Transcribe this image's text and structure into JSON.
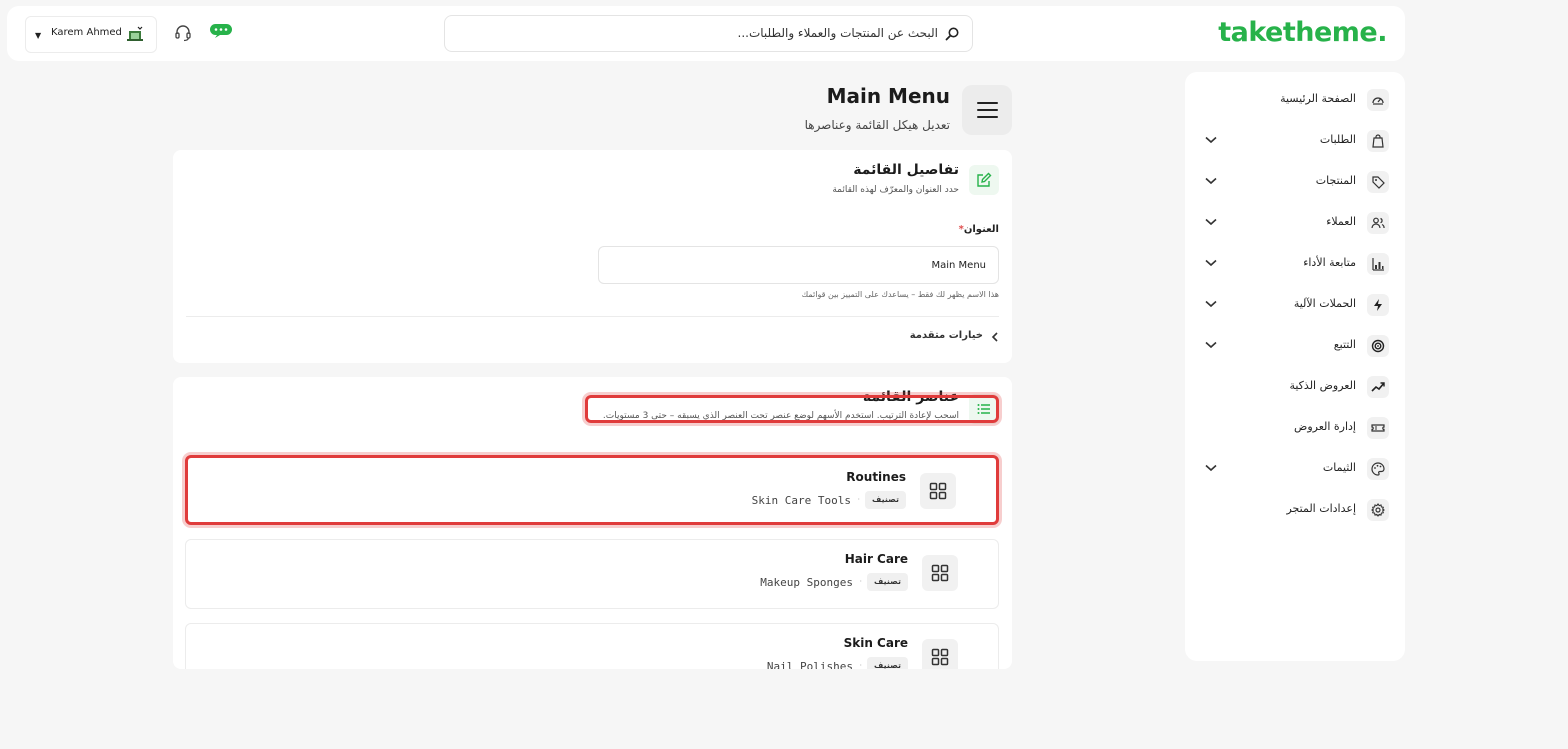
{
  "header": {
    "logo": "taketheme.",
    "search_placeholder": "البحث عن المنتجات والعملاء والطلبات...",
    "user_name": "Karem Ahmed"
  },
  "sidebar": {
    "items": [
      {
        "label": "الصفحة الرئيسية",
        "icon": "dashboard-icon",
        "has_chevron": false
      },
      {
        "label": "الطلبات",
        "icon": "shopping-bag-icon",
        "has_chevron": true
      },
      {
        "label": "المنتجات",
        "icon": "tag-icon",
        "has_chevron": true
      },
      {
        "label": "العملاء",
        "icon": "users-icon",
        "has_chevron": true
      },
      {
        "label": "متابعة الأداء",
        "icon": "bar-chart-icon",
        "has_chevron": true
      },
      {
        "label": "الحملات الآلية",
        "icon": "lightning-icon",
        "has_chevron": true
      },
      {
        "label": "التتبع",
        "icon": "target-icon",
        "has_chevron": true
      },
      {
        "label": "العروض الذكية",
        "icon": "trending-icon",
        "has_chevron": false
      },
      {
        "label": "إدارة العروض",
        "icon": "ticket-icon",
        "has_chevron": false
      },
      {
        "label": "الثيمات",
        "icon": "palette-icon",
        "has_chevron": true
      },
      {
        "label": "إعدادات المتجر",
        "icon": "gear-icon",
        "has_chevron": false
      }
    ]
  },
  "page": {
    "title": "Main Menu",
    "subtitle": "تعديل هيكل القائمة وعناصرها"
  },
  "details_card": {
    "title": "تفاصيل القائمة",
    "description": "حدد العنوان والمعرّف لهذه القائمة",
    "field_label": "العنوان",
    "required_mark": "*",
    "field_value": "Main Menu",
    "field_help": "هذا الاسم يظهر لك فقط – يساعدك على التمييز بين قوائمك",
    "advanced_label": "خيارات متقدمة"
  },
  "items_card": {
    "title": "عناصر القائمة",
    "description": "اسحب لإعادة الترتيب. استخدم الأسهم لوضع عنصر تحت العنصر الذي يسبقه – حتى 3 مستويات.",
    "items": [
      {
        "title": "Routines",
        "badge": "تصنيف",
        "sub": "Skin Care Tools",
        "highlighted": true
      },
      {
        "title": "Hair Care",
        "badge": "تصنيف",
        "sub": "Makeup Sponges",
        "highlighted": false
      },
      {
        "title": "Skin Care",
        "badge": "تصنيف",
        "sub": "Nail Polishes",
        "highlighted": false
      }
    ]
  },
  "colors": {
    "brand": "#27b24a",
    "highlight": "#e03b3b",
    "background": "#f6f6f6"
  }
}
